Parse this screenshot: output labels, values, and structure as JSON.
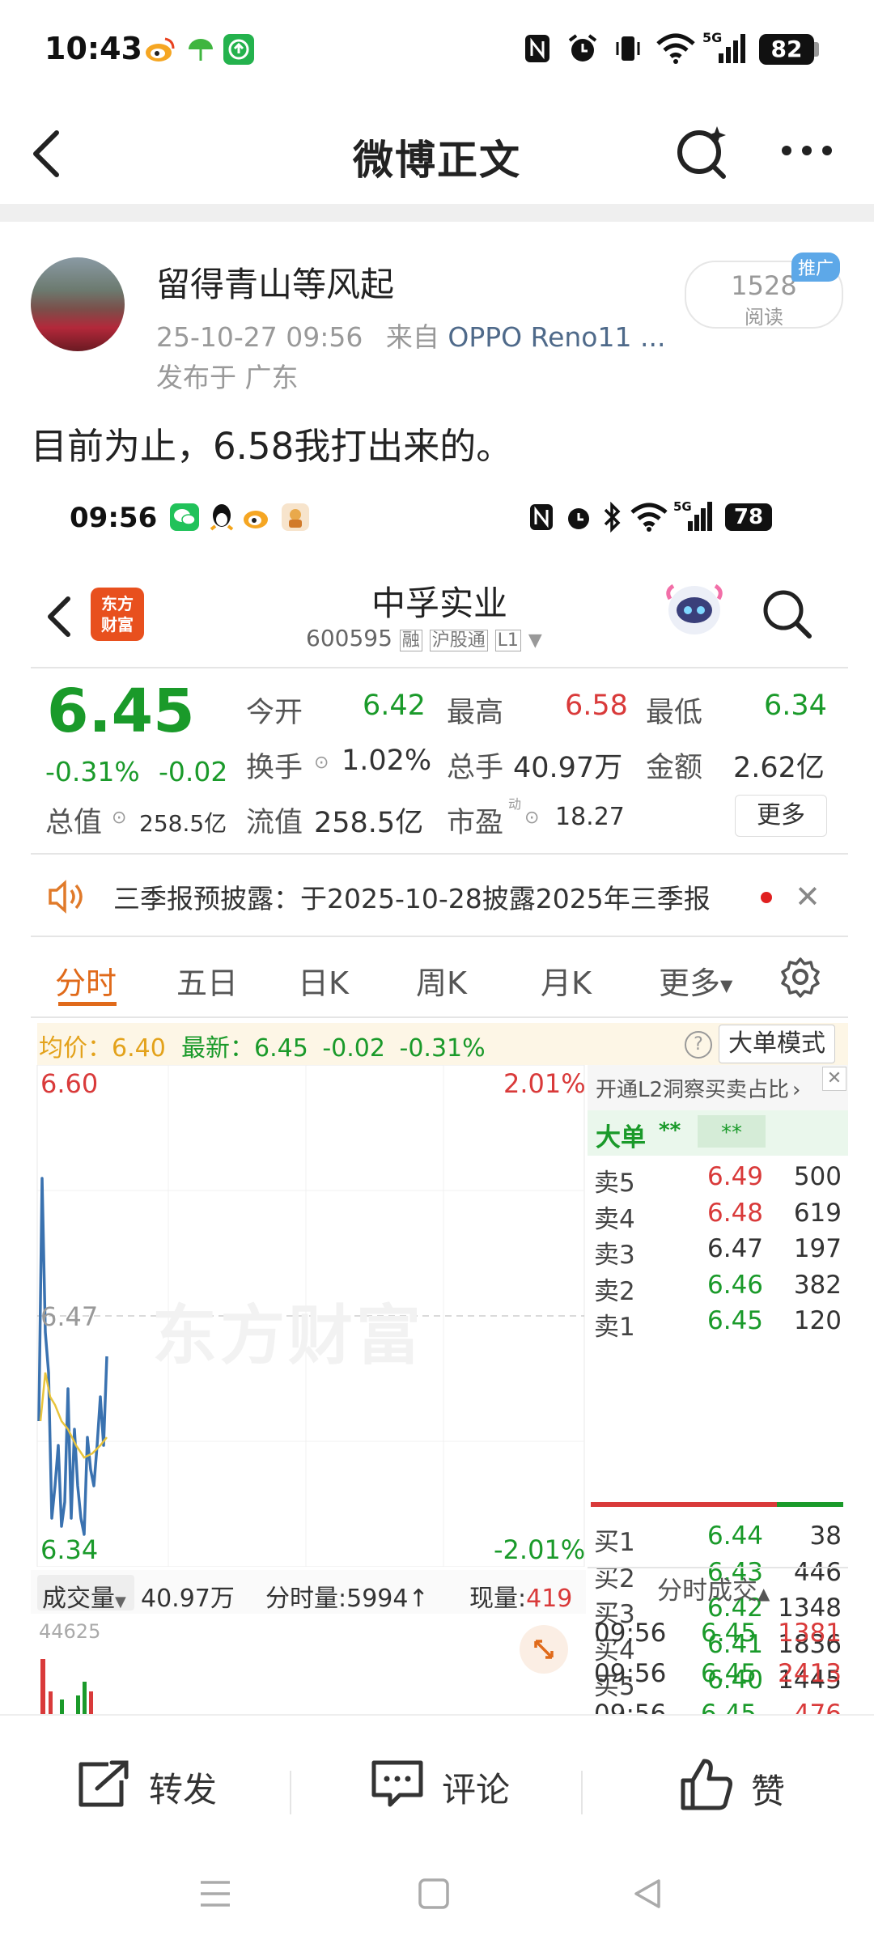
{
  "status_bar": {
    "time": "10:43",
    "battery": "82",
    "network": "5G"
  },
  "nav": {
    "title": "微博正文"
  },
  "post": {
    "author": "留得青山等风起",
    "timestamp": "25-10-27 09:56",
    "source_prefix": "来自",
    "source": "OPPO Reno11 ...",
    "location": "发布于 广东",
    "reads": "1528",
    "reads_label": "阅读",
    "promo_tag": "推广",
    "text": "目前为止，6.58我打出来的。"
  },
  "screenshot": {
    "status_bar": {
      "time": "09:56",
      "battery": "78"
    },
    "app_logo": "东方\n财富",
    "stock_name": "中孚实业",
    "stock_code": "600595",
    "stock_tags": [
      "融",
      "沪股通",
      "L1"
    ],
    "price": "6.45",
    "change_pct": "-0.31%",
    "change": "-0.02",
    "stats": {
      "open_label": "今开",
      "open": "6.42",
      "high_label": "最高",
      "high": "6.58",
      "low_label": "最低",
      "low": "6.34",
      "turnover_label": "换手",
      "turnover": "1.02%",
      "volume_label": "总手",
      "volume": "40.97万",
      "amount_label": "金额",
      "amount": "2.62亿",
      "mktcap_label": "总值",
      "mktcap": "258.5亿",
      "float_label": "流值",
      "float": "258.5亿",
      "pe_label": "市盈",
      "pe_sup": "动",
      "pe": "18.27",
      "more": "更多"
    },
    "notice": "三季报预披露：于2025-10-28披露2025年三季报",
    "tabs": [
      "分时",
      "五日",
      "日K",
      "周K",
      "月K",
      "更多"
    ],
    "avg_label": "均价：",
    "avg": "6.40",
    "latest_label": "最新：",
    "latest": "6.45",
    "latest_change": "-0.02",
    "latest_pct": "-0.31%",
    "mode_button": "大单模式",
    "chart": {
      "y_top": "6.60",
      "y_mid": "6.47",
      "y_bottom": "6.34",
      "pct_top": "2.01%",
      "pct_bottom": "-2.01%",
      "watermark": "东方财富"
    },
    "l2_banner": "开通L2洞察买卖占比",
    "bigorder_label": "大单",
    "bigorder_values": [
      "**",
      "**"
    ],
    "sells": [
      {
        "label": "卖5",
        "price": "6.49",
        "vol": "500",
        "color": "red"
      },
      {
        "label": "卖4",
        "price": "6.48",
        "vol": "619",
        "color": "red"
      },
      {
        "label": "卖3",
        "price": "6.47",
        "vol": "197",
        "color": "gray"
      },
      {
        "label": "卖2",
        "price": "6.46",
        "vol": "382",
        "color": "green"
      },
      {
        "label": "卖1",
        "price": "6.45",
        "vol": "120",
        "color": "green"
      }
    ],
    "buys": [
      {
        "label": "买1",
        "price": "6.44",
        "vol": "38",
        "color": "green"
      },
      {
        "label": "买2",
        "price": "6.43",
        "vol": "446",
        "color": "green"
      },
      {
        "label": "买3",
        "price": "6.42",
        "vol": "1348",
        "color": "green"
      },
      {
        "label": "买4",
        "price": "6.41",
        "vol": "1836",
        "color": "green"
      },
      {
        "label": "买5",
        "price": "6.40",
        "vol": "1445",
        "color": "green"
      }
    ],
    "ticks_header": "分时成交",
    "ticks": [
      {
        "time": "09:56",
        "price": "6.45",
        "vol": "1381"
      },
      {
        "time": "09:56",
        "price": "6.45",
        "vol": "2413"
      },
      {
        "time": "09:56",
        "price": "6.45",
        "vol": "476"
      }
    ],
    "volume_bar": {
      "selector": "成交量",
      "total": "40.97万",
      "period_label": "分时量:5994",
      "now_label": "现量:",
      "now": "419",
      "max": "44625"
    }
  },
  "actions": {
    "repost": "转发",
    "comment": "评论",
    "like": "赞"
  }
}
